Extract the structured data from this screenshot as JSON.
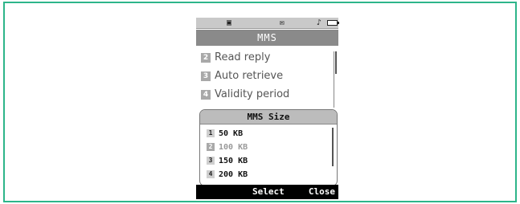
{
  "status_bar": {
    "icons": [
      "signal-icon",
      "message-icon",
      "music-note-icon",
      "battery-icon"
    ],
    "glyphs": {
      "signal": "▣",
      "message": "✉",
      "music": "♪"
    }
  },
  "title": "MMS",
  "menu": {
    "items": [
      {
        "number": "2",
        "label": "Read reply"
      },
      {
        "number": "3",
        "label": "Auto retrieve"
      },
      {
        "number": "4",
        "label": "Validity period"
      }
    ]
  },
  "popup": {
    "title": "MMS Size",
    "options": [
      {
        "number": "1",
        "label": "50 KB",
        "selected": false
      },
      {
        "number": "2",
        "label": "100 KB",
        "selected": true
      },
      {
        "number": "3",
        "label": "150 KB",
        "selected": false
      },
      {
        "number": "4",
        "label": "200 KB",
        "selected": false
      }
    ]
  },
  "softkeys": {
    "left": "Select",
    "right": "Close"
  },
  "colors": {
    "frame_border": "#2db58a",
    "title_bar": "#8a8a8a",
    "softkey_bar": "#000000"
  }
}
